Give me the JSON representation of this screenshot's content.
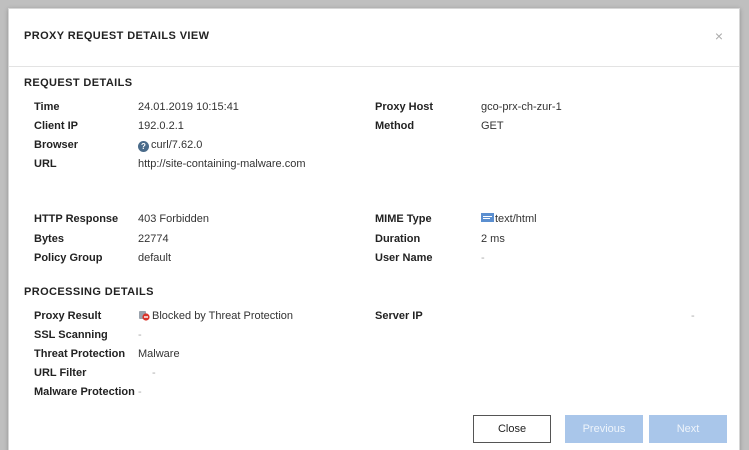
{
  "dialog": {
    "title": "PROXY REQUEST DETAILS VIEW",
    "close_glyph": "×"
  },
  "request": {
    "title": "REQUEST DETAILS",
    "time_label": "Time",
    "time_value": "24.01.2019 10:15:41",
    "client_ip_label": "Client IP",
    "client_ip_value": "192.0.2.1",
    "browser_label": "Browser",
    "browser_value": "curl/7.62.0",
    "url_label": "URL",
    "url_value": "http://site-containing-malware.com",
    "proxy_host_label": "Proxy Host",
    "proxy_host_value": "gco-prx-ch-zur-1",
    "method_label": "Method",
    "method_value": "GET",
    "http_response_label": "HTTP Response",
    "http_response_value": "403 Forbidden",
    "bytes_label": "Bytes",
    "bytes_value": "22774",
    "policy_group_label": "Policy Group",
    "policy_group_value": "default",
    "mime_type_label": "MIME Type",
    "mime_type_value": "text/html",
    "duration_label": "Duration",
    "duration_value": "2 ms",
    "user_name_label": "User Name",
    "user_name_value": "-"
  },
  "processing": {
    "title": "PROCESSING DETAILS",
    "proxy_result_label": "Proxy Result",
    "proxy_result_value": "Blocked by Threat Protection",
    "ssl_scanning_label": "SSL Scanning",
    "ssl_scanning_value": "-",
    "threat_protection_label": "Threat Protection",
    "threat_protection_value": "Malware",
    "url_filter_label": "URL Filter",
    "url_filter_value": "-",
    "malware_protection_label": "Malware Protection",
    "malware_protection_value": "-",
    "server_ip_label": "Server IP",
    "server_ip_value": "-"
  },
  "buttons": {
    "close_label": "Close",
    "previous_label": "Previous",
    "next_label": "Next"
  },
  "icons": {
    "browser_icon": "help-icon",
    "mime_icon": "html-file-icon",
    "threat_icon": "threat-blocked-icon"
  },
  "colors": {
    "primary_disabled": "#a9c6ea",
    "help_icon": "#4a6b8a"
  }
}
